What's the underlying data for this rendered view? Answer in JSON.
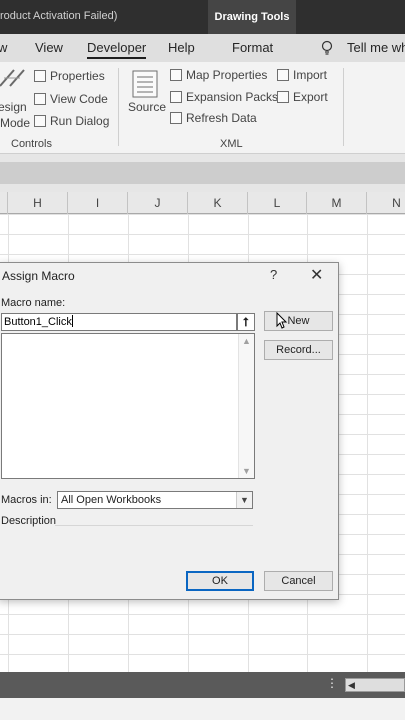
{
  "titlebar": {
    "window_title": "roduct Activation Failed)",
    "context_tab": "Drawing Tools"
  },
  "ribbon_tabs": [
    "w",
    "View",
    "Developer",
    "Help",
    "Format",
    "Tell me wh"
  ],
  "ribbon": {
    "controls": {
      "design_mode": [
        "esign",
        "Mode"
      ],
      "properties": "Properties",
      "view_code": "View Code",
      "run_dialog": "Run Dialog",
      "group_label": "Controls"
    },
    "xml": {
      "source": "Source",
      "map_properties": "Map Properties",
      "expansion_packs": "Expansion Packs",
      "refresh_data": "Refresh Data",
      "import": "Import",
      "export": "Export",
      "group_label": "XML"
    }
  },
  "sheet": {
    "columns": [
      "H",
      "I",
      "J",
      "K",
      "L",
      "M",
      "N"
    ]
  },
  "dialog": {
    "title": "Assign Macro",
    "help": "?",
    "close": "✕",
    "macro_name_label": "Macro name:",
    "macro_name_value": "Button1_Click",
    "new_button": "New",
    "record_button": "Record...",
    "macros_in_label": "Macros in:",
    "macros_in_value": "All Open Workbooks",
    "description_label": "Description",
    "ok_button": "OK",
    "cancel_button": "Cancel"
  },
  "colors": {
    "title_bar": "#2f2f2f",
    "ribbon": "#f3f3f3",
    "dialog_bg": "#f0f0f0",
    "default_button_border": "#0a66c2"
  }
}
